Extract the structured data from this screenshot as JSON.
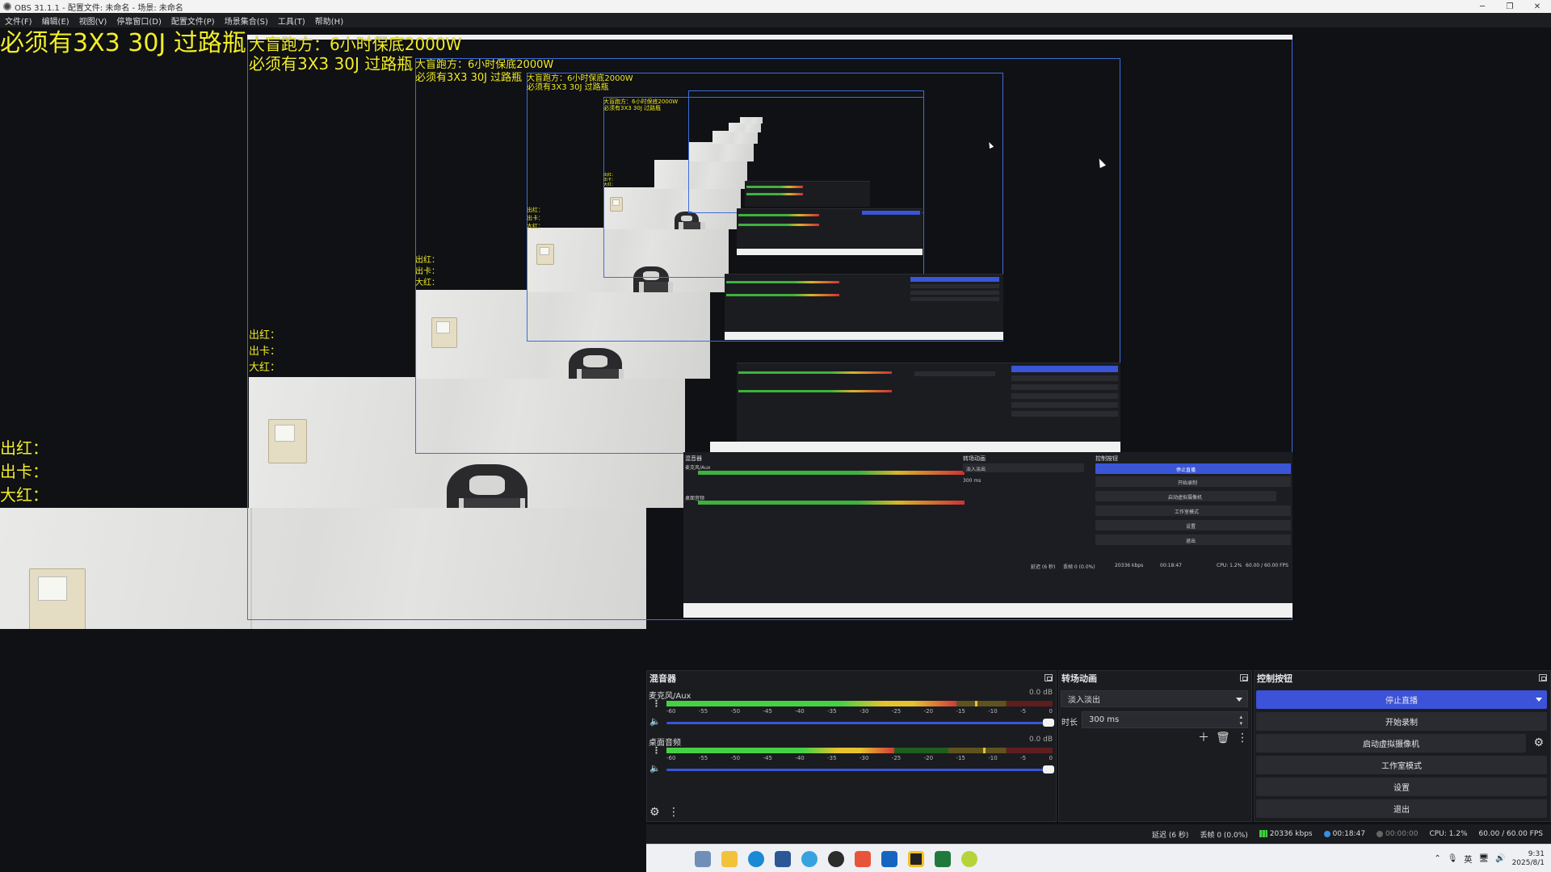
{
  "window": {
    "title": "OBS 31.1.1 - 配置文件: 未命名 - 场景: 未命名",
    "controls": [
      "─",
      "❐",
      "✕"
    ]
  },
  "menu": [
    "文件(F)",
    "编辑(E)",
    "视图(V)",
    "停靠窗口(D)",
    "配置文件(P)",
    "场景集合(S)",
    "工具(T)",
    "帮助(H)"
  ],
  "overlay": {
    "line1": "大盲跑方：6小时保底2000W",
    "line2": "必须有3X3 30J 过路瓶",
    "stat1": "出红：",
    "stat2": "出卡：",
    "stat3": "大红："
  },
  "mixer": {
    "title": "混音器",
    "tracks": [
      {
        "name": "麦克风/Aux",
        "db": "0.0 dB",
        "level": 0.75,
        "peak": 0.8
      },
      {
        "name": "桌面音频",
        "db": "0.0 dB",
        "level": 0.59,
        "peak": 0.82
      }
    ],
    "ticks": [
      "-60",
      "-55",
      "-50",
      "-45",
      "-40",
      "-35",
      "-30",
      "-25",
      "-20",
      "-15",
      "-10",
      "-5",
      "0"
    ]
  },
  "transition": {
    "title": "转场动画",
    "type": "淡入淡出",
    "duration_label": "时长",
    "duration": "300 ms"
  },
  "controls": {
    "title": "控制按钮",
    "stop_stream": "停止直播",
    "start_record": "开始录制",
    "virtual_cam": "启动虚拟摄像机",
    "studio_mode": "工作室模式",
    "settings": "设置",
    "exit": "退出"
  },
  "status": {
    "delay": "延迟 (6 秒)",
    "dropped": "丢帧 0 (0.0%)",
    "bitrate": "20336 kbps",
    "stream_time": "00:18:47",
    "record_time": "00:00:00",
    "cpu": "CPU: 1.2%",
    "fps": "60.00 / 60.00 FPS"
  },
  "tray": {
    "lang": "英",
    "time": "9:31",
    "date": "2025/8/1"
  },
  "colors": {
    "accent": "#3c52d8",
    "overlay_text": "#f2ee2a",
    "panel": "#1b1c20"
  },
  "icons": [
    "chevron-up-icon",
    "microphone-icon",
    "network-icon",
    "speaker-icon",
    "gear-icon",
    "kebab-icon",
    "plus-icon",
    "trash-icon",
    "float-icon"
  ]
}
